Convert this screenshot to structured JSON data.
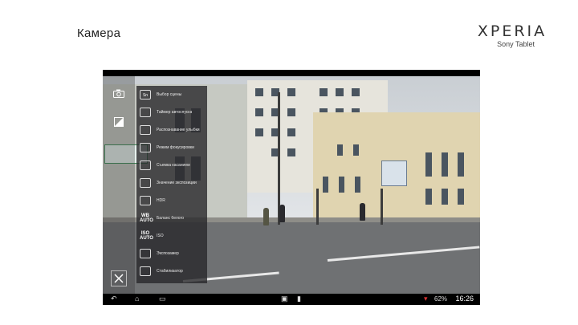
{
  "slide": {
    "title": "Камера"
  },
  "brand": {
    "main": "XPERIA",
    "sub": "Sony Tablet"
  },
  "camera_ui": {
    "left_bar": {
      "mode_icon": "camera-icon",
      "effect_icon": "exposure-icon",
      "settings_icon": "tools-icon"
    },
    "menu": [
      {
        "icon": "scene-icon",
        "code": "Sn",
        "label": "Выбор сцены"
      },
      {
        "icon": "self-timer-icon",
        "code": "",
        "label": "Таймер автоспуска"
      },
      {
        "icon": "smile-shutter-icon",
        "code": "",
        "label": "Распознавание улыбки"
      },
      {
        "icon": "focus-mode-icon",
        "code": "",
        "label": "Режим фокусировки"
      },
      {
        "icon": "touch-capture-icon",
        "code": "",
        "label": "Съемка касанием"
      },
      {
        "icon": "exposure-value-icon",
        "code": "",
        "label": "Значение экспозиции"
      },
      {
        "icon": "hdr-icon",
        "code": "",
        "label": "HDR"
      },
      {
        "icon": "white-balance-icon",
        "code": "WB AUTO",
        "label": "Баланс белого"
      },
      {
        "icon": "iso-icon",
        "code": "ISO AUTO",
        "label": "ISO"
      },
      {
        "icon": "metering-icon",
        "code": "",
        "label": "Экспозамер"
      },
      {
        "icon": "stabilizer-icon",
        "code": "",
        "label": "Стабилизатор"
      }
    ]
  },
  "status_bar": {
    "battery": "62%",
    "time": "16:26"
  }
}
